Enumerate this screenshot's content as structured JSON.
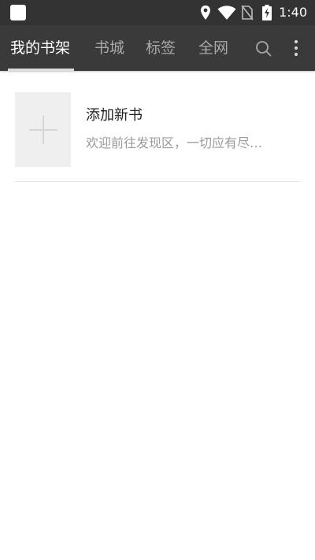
{
  "status_bar": {
    "time": "1:40",
    "icons": [
      "app-icon",
      "location-icon",
      "wifi-icon",
      "no-sim-icon",
      "battery-charging-icon"
    ]
  },
  "toolbar": {
    "tabs": [
      {
        "label": "我的书架",
        "active": true
      },
      {
        "label": "书城",
        "active": false
      },
      {
        "label": "标签",
        "active": false
      },
      {
        "label": "全网",
        "active": false
      }
    ],
    "actions": [
      "search-icon",
      "more-vert-icon"
    ]
  },
  "bookshelf": {
    "items": [
      {
        "title": "添加新书",
        "description": "欢迎前往发现区，一切应有尽…",
        "cover_icon": "plus-icon"
      }
    ]
  },
  "colors": {
    "status_bar": "#333333",
    "app_bar": "#3a3a3a",
    "tab_active": "#ffffff",
    "tab_inactive": "#a9a9a9",
    "background": "#ffffff"
  }
}
